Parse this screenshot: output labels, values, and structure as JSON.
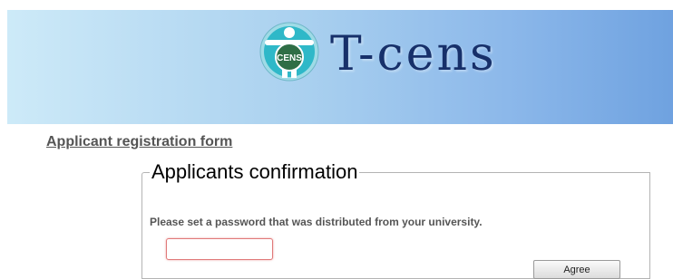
{
  "header": {
    "brand_title": "T-cens",
    "logo_text": "CENS",
    "banner_colors": [
      "#cdeaf8",
      "#8cb8ea",
      "#6fa2e0"
    ],
    "logo_colors": {
      "ring": "#1d8a8a",
      "center": "#2f6e46",
      "figure": "#2fb8c8"
    }
  },
  "page": {
    "form_link": "Applicant registration form"
  },
  "confirmation": {
    "legend": "Applicants confirmation",
    "instructions": "Please set a password that was distributed from your university.",
    "password": {
      "value": "",
      "placeholder": ""
    },
    "agree_label": "Agree"
  }
}
